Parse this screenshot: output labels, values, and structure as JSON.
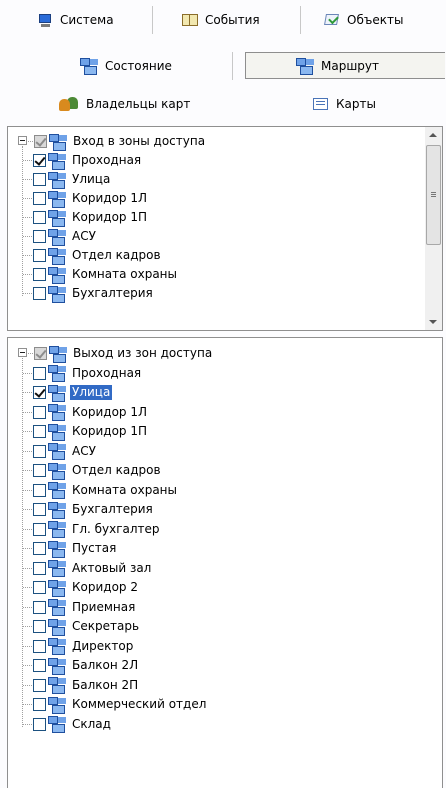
{
  "tabs": {
    "row1": [
      {
        "label": "Система",
        "icon": "monitor-icon"
      },
      {
        "label": "События",
        "icon": "book-icon"
      },
      {
        "label": "Объекты",
        "icon": "objects-icon"
      }
    ],
    "row2": [
      {
        "label": "Состояние",
        "icon": "zone-icon"
      },
      {
        "label": "Маршрут",
        "icon": "zone-icon",
        "selected": true
      }
    ],
    "row3": [
      {
        "label": "Владельцы карт",
        "icon": "users-icon"
      },
      {
        "label": "Карты",
        "icon": "card-icon"
      }
    ]
  },
  "entry_tree": {
    "root": "Вход в зоны доступа",
    "items": [
      {
        "label": "Проходная",
        "checked": true
      },
      {
        "label": "Улица",
        "checked": false
      },
      {
        "label": "Коридор 1Л",
        "checked": false
      },
      {
        "label": "Коридор 1П",
        "checked": false
      },
      {
        "label": "АСУ",
        "checked": false
      },
      {
        "label": "Отдел кадров",
        "checked": false
      },
      {
        "label": "Комната охраны",
        "checked": false
      },
      {
        "label": "Бухгалтерия",
        "checked": false
      }
    ]
  },
  "exit_tree": {
    "root": "Выход из зон доступа",
    "items": [
      {
        "label": "Проходная",
        "checked": false
      },
      {
        "label": "Улица",
        "checked": true,
        "selected": true
      },
      {
        "label": "Коридор 1Л",
        "checked": false
      },
      {
        "label": "Коридор 1П",
        "checked": false
      },
      {
        "label": "АСУ",
        "checked": false
      },
      {
        "label": "Отдел кадров",
        "checked": false
      },
      {
        "label": "Комната охраны",
        "checked": false
      },
      {
        "label": "Бухгалтерия",
        "checked": false
      },
      {
        "label": "Гл. бухгалтер",
        "checked": false
      },
      {
        "label": "Пустая",
        "checked": false
      },
      {
        "label": "Актовый зал",
        "checked": false
      },
      {
        "label": "Коридор 2",
        "checked": false
      },
      {
        "label": "Приемная",
        "checked": false
      },
      {
        "label": "Секретарь",
        "checked": false
      },
      {
        "label": "Директор",
        "checked": false
      },
      {
        "label": "Балкон 2Л",
        "checked": false
      },
      {
        "label": "Балкон 2П",
        "checked": false
      },
      {
        "label": "Коммерческий отдел",
        "checked": false
      },
      {
        "label": "Склад",
        "checked": false
      }
    ]
  },
  "colors": {
    "selection": "#316ac5",
    "accent": "#1f4f9e"
  }
}
